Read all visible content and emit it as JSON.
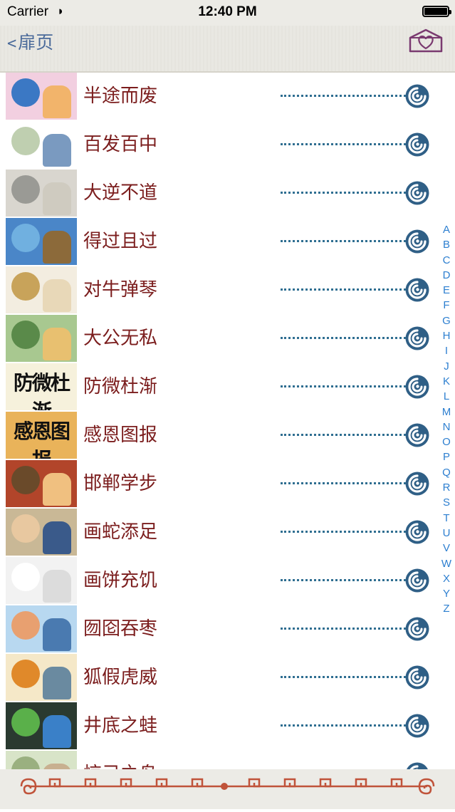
{
  "status_bar": {
    "carrier": "Carrier",
    "time": "12:40 PM"
  },
  "nav": {
    "back_label": "扉页",
    "fav_icon": "heart-box-icon"
  },
  "colors": {
    "label": "#7b1d1d",
    "dots": "#2f6e91",
    "index": "#2d7fd0",
    "back": "#4a6a9a"
  },
  "list": {
    "items": [
      {
        "label": "半途而废",
        "thumb_caption": ""
      },
      {
        "label": "百发百中",
        "thumb_caption": ""
      },
      {
        "label": "大逆不道",
        "thumb_caption": ""
      },
      {
        "label": "得过且过",
        "thumb_caption": ""
      },
      {
        "label": "对牛弹琴",
        "thumb_caption": ""
      },
      {
        "label": "大公无私",
        "thumb_caption": ""
      },
      {
        "label": "防微杜渐",
        "thumb_caption": "防微杜渐"
      },
      {
        "label": "感恩图报",
        "thumb_caption": "感恩图报"
      },
      {
        "label": "邯郸学步",
        "thumb_caption": ""
      },
      {
        "label": "画蛇添足",
        "thumb_caption": ""
      },
      {
        "label": "画饼充饥",
        "thumb_caption": ""
      },
      {
        "label": "囫囵吞枣",
        "thumb_caption": ""
      },
      {
        "label": "狐假虎威",
        "thumb_caption": ""
      },
      {
        "label": "井底之蛙",
        "thumb_caption": ""
      },
      {
        "label": "惊弓之鸟",
        "thumb_caption": ""
      }
    ]
  },
  "index_letters": [
    "A",
    "B",
    "C",
    "D",
    "E",
    "F",
    "G",
    "H",
    "I",
    "J",
    "K",
    "L",
    "M",
    "N",
    "O",
    "P",
    "Q",
    "R",
    "S",
    "T",
    "U",
    "V",
    "W",
    "X",
    "Y",
    "Z"
  ]
}
